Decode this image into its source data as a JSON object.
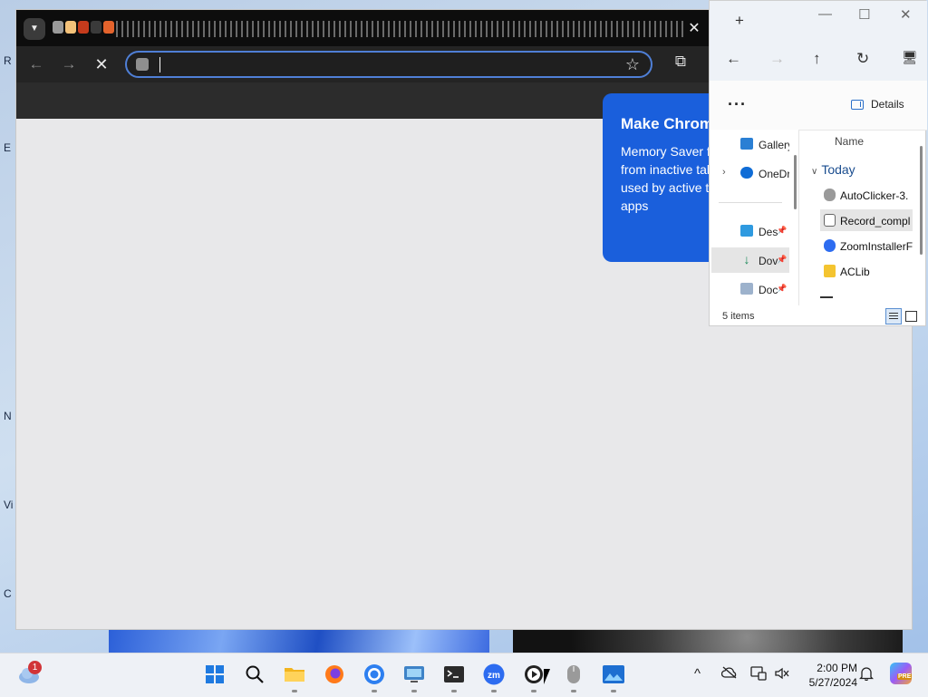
{
  "desktop": {
    "icon_labels": [
      "R",
      "E",
      "N",
      "Vi",
      "C"
    ]
  },
  "chrome": {
    "tab_search_icon": "chevron-down-icon",
    "close_tab": "✕",
    "nav": {
      "back": "←",
      "forward": "→",
      "stop": "✕"
    },
    "omnibox": {
      "value": "",
      "placeholder": ""
    },
    "bookmark_icon": "star-icon",
    "extensions_icon": "puzzle-icon",
    "promo": {
      "title": "Make Chrom",
      "body": "Memory Saver frees up memory from inactive tabs so it can be used by active tabs and other apps",
      "background": "#1a5fdc"
    }
  },
  "explorer": {
    "new_tab": "+",
    "window_buttons": {
      "minimize": "—",
      "maximize": "☐",
      "close": "✕"
    },
    "nav_buttons": {
      "back": "←",
      "forward": "→",
      "up": "↑",
      "refresh": "↻",
      "this_pc": "🖥"
    },
    "more_label": "···",
    "details_label": "Details",
    "nav_pane": {
      "items": [
        {
          "label": "Gallery",
          "icon": "gallery-icon",
          "pinned": false
        },
        {
          "label": "OneDr",
          "icon": "onedrive-icon",
          "pinned": false,
          "expandable": true
        },
        {
          "label": "Des",
          "icon": "desktop-icon",
          "pinned": true
        },
        {
          "label": "Dov",
          "icon": "downloads-icon",
          "pinned": true,
          "selected": true
        },
        {
          "label": "Doc",
          "icon": "documents-icon",
          "pinned": true
        }
      ]
    },
    "files": {
      "column_header": "Name",
      "group": "Today",
      "items": [
        {
          "label": "AutoClicker-3.",
          "icon": "mouse-icon"
        },
        {
          "label": "Record_compl",
          "icon": "recording-icon",
          "selected": true
        },
        {
          "label": "ZoomInstallerF",
          "icon": "zoom-icon"
        },
        {
          "label": "ACLib",
          "icon": "folder-icon"
        }
      ]
    },
    "status": "5 items"
  },
  "taskbar": {
    "weather_badge": "1",
    "apps": [
      {
        "name": "start",
        "icon": "windows-icon"
      },
      {
        "name": "search",
        "icon": "search-icon"
      },
      {
        "name": "file-explorer",
        "icon": "folder-icon",
        "open": true
      },
      {
        "name": "firefox",
        "icon": "firefox-icon"
      },
      {
        "name": "chrome",
        "icon": "chrome-icon",
        "open": true
      },
      {
        "name": "remote-desktop",
        "icon": "remote-desktop-icon",
        "open": true
      },
      {
        "name": "terminal",
        "icon": "terminal-icon",
        "open": true
      },
      {
        "name": "zoom",
        "icon": "zoom-icon",
        "open": true
      },
      {
        "name": "media-player",
        "icon": "play-icon",
        "open": true
      },
      {
        "name": "autoclicker",
        "icon": "mouse-icon",
        "open": true
      },
      {
        "name": "photos",
        "icon": "photos-icon",
        "open": true
      }
    ],
    "tray": {
      "chevron": "^",
      "time": "2:00 PM",
      "date": "5/27/2024",
      "copilot_tag": "PRE"
    }
  }
}
